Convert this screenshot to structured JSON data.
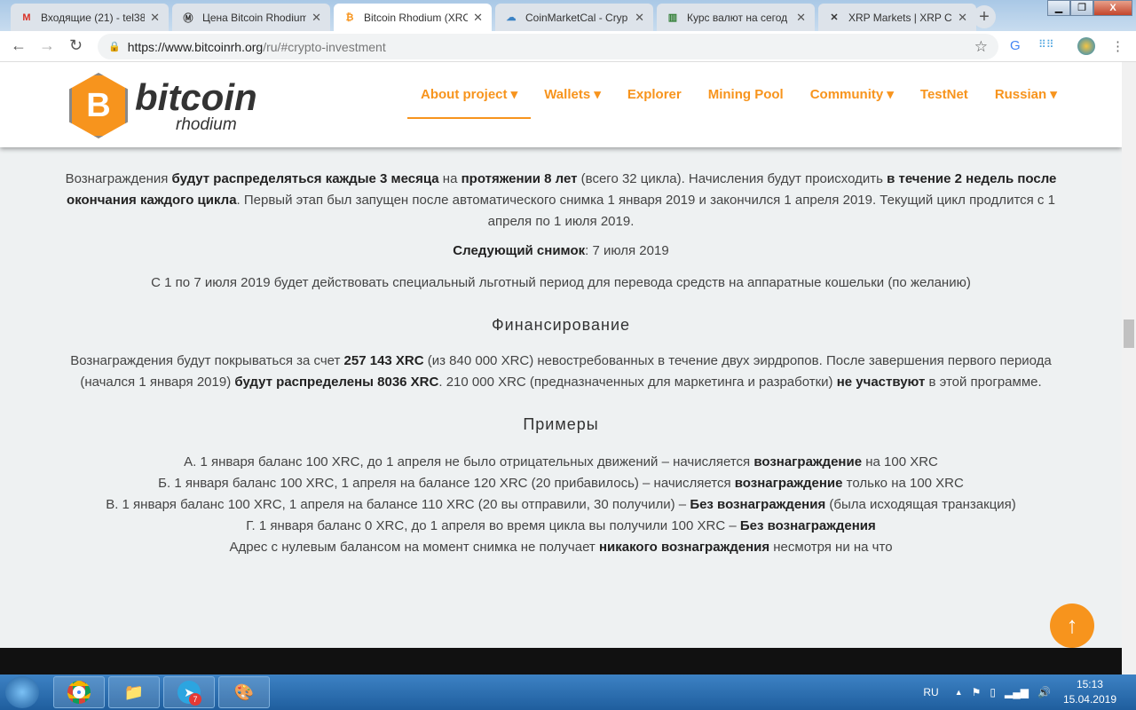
{
  "browser": {
    "tabs": [
      {
        "label": "Входящие (21) - tel38",
        "icon": "gmail-icon",
        "glyph": "M",
        "color": "#d93025"
      },
      {
        "label": "Цена Bitcoin Rhodium",
        "icon": "coinmarket-icon",
        "glyph": "Ⓜ",
        "color": "#333"
      },
      {
        "label": "Bitcoin Rhodium (XRC",
        "icon": "bitcoin-rhodium-icon",
        "glyph": "₿",
        "color": "#f7941d"
      },
      {
        "label": "CoinMarketCal - Cryp",
        "icon": "coinmarketcal-icon",
        "glyph": "☁",
        "color": "#3b82c4"
      },
      {
        "label": "Курс валют на сегод",
        "icon": "bars-icon",
        "glyph": "▥",
        "color": "#2e7d32"
      },
      {
        "label": "XRP Markets | XRP Ch",
        "icon": "xrp-icon",
        "glyph": "✕",
        "color": "#333"
      }
    ],
    "url_host": "https://www.bitcoinrh.org",
    "url_path": "/ru/#crypto-investment"
  },
  "site": {
    "logo_main": "bitcoin",
    "logo_sub": "rhodium",
    "menu": [
      "About project ▾",
      "Wallets ▾",
      "Explorer",
      "Mining Pool",
      "Community ▾",
      "TestNet",
      "Russian ▾"
    ],
    "accent": "#f7941d"
  },
  "content": {
    "p1": [
      {
        "t": "Вознаграждения "
      },
      {
        "t": "будут распределяться каждые 3 месяца",
        "b": 1
      },
      {
        "t": " на "
      },
      {
        "t": "протяжении 8 лет",
        "b": 1
      },
      {
        "t": " (всего 32 цикла). Начисления будут происходить "
      },
      {
        "t": "в течение 2 недель после окончания каждого цикла",
        "b": 1
      },
      {
        "t": ". Первый этап был запущен после автоматического снимка 1 января 2019 и закончился 1 апреля 2019. Текущий цикл продлится с 1 апреля по 1 июля 2019."
      }
    ],
    "p2": [
      {
        "t": "Следующий снимок",
        "b": 1
      },
      {
        "t": ": 7 июля 2019"
      }
    ],
    "p3": [
      {
        "t": "С 1 по 7 июля 2019 будет действовать специальный льготный период для перевода средств на аппаратные кошельки (по желанию)"
      }
    ],
    "h_funding": "Финансирование",
    "p4": [
      {
        "t": "Вознаграждения будут покрываться за счет "
      },
      {
        "t": "257 143 XRC",
        "b": 1
      },
      {
        "t": " (из 840 000 XRC) невостребованных в течение двух эирдропов. После завершения первого периода (начался 1 января 2019) "
      },
      {
        "t": "будут распределены 8036 XRC",
        "b": 1
      },
      {
        "t": ". 210 000 XRC (предназначенных для маркетинга и разработки) "
      },
      {
        "t": "не участвуют",
        "b": 1
      },
      {
        "t": " в этой программе."
      }
    ],
    "h_examples": "Примеры",
    "examples": [
      [
        {
          "t": "А. 1 января баланс 100 XRC, до 1 апреля не было отрицательных движений – начисляется "
        },
        {
          "t": "вознаграждение",
          "b": 1
        },
        {
          "t": " на 100 XRC"
        }
      ],
      [
        {
          "t": "Б. 1 января баланс 100 XRC, 1 апреля на балансе 120 XRC (20 прибавилось) – начисляется "
        },
        {
          "t": "вознаграждение",
          "b": 1
        },
        {
          "t": " только на 100 XRC"
        }
      ],
      [
        {
          "t": "В. 1 января баланс 100 XRC, 1 апреля на балансе 110 XRC (20 вы отправили, 30 получили) – "
        },
        {
          "t": "Без вознаграждения",
          "b": 1
        },
        {
          "t": " (была исходящая транзакция)"
        }
      ],
      [
        {
          "t": "Г. 1 января баланс 0 XRC, до 1 апреля во время цикла вы получили 100 XRC – "
        },
        {
          "t": "Без вознаграждения",
          "b": 1
        }
      ],
      [
        {
          "t": "Адрес с нулевым балансом на момент снимка не получает "
        },
        {
          "t": "никакого вознаграждения",
          "b": 1
        },
        {
          "t": " несмотря ни на что"
        }
      ]
    ]
  },
  "taskbar": {
    "lang": "RU",
    "time": "15:13",
    "date": "15.04.2019",
    "telegram_badge": "7"
  }
}
